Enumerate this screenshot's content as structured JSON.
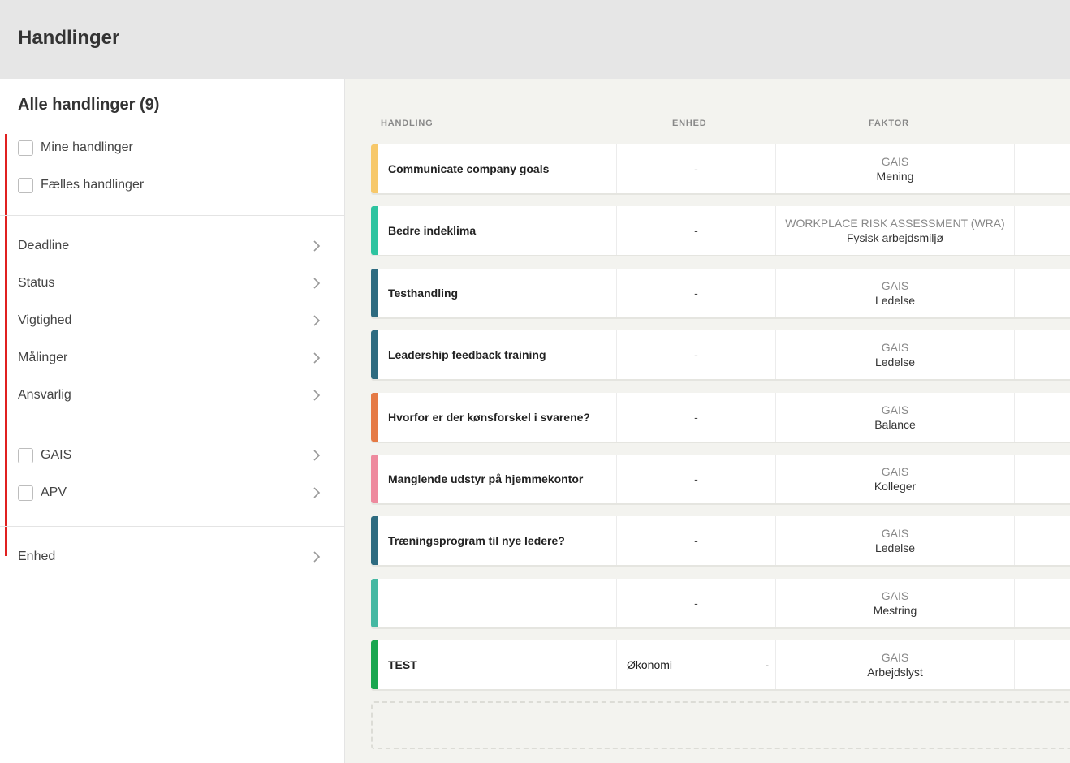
{
  "header": {
    "title": "Handlinger"
  },
  "sidebar": {
    "title": "Alle handlinger (9)",
    "checks": [
      {
        "label": "Mine handlinger"
      },
      {
        "label": "Fælles handlinger"
      }
    ],
    "filters": [
      {
        "label": "Deadline"
      },
      {
        "label": "Status"
      },
      {
        "label": "Vigtighed"
      },
      {
        "label": "Målinger"
      },
      {
        "label": "Ansvarlig"
      }
    ],
    "sources": [
      {
        "label": "GAIS"
      },
      {
        "label": "APV"
      }
    ],
    "unit_filter": {
      "label": "Enhed"
    }
  },
  "table": {
    "columns": {
      "action": "HANDLING",
      "unit": "ENHED",
      "factor": "FAKTOR"
    },
    "rows": [
      {
        "name": "Communicate company goals",
        "unit": "-",
        "factor_type": "GAIS",
        "factor": "Mening",
        "color": "#f7c86a"
      },
      {
        "name": "Bedre indeklima",
        "unit": "-",
        "factor_type": "WORKPLACE RISK ASSESSMENT (WRA)",
        "factor": "Fysisk arbejdsmiljø",
        "color": "#2ec4a0"
      },
      {
        "name": "Testhandling",
        "unit": "-",
        "factor_type": "GAIS",
        "factor": "Ledelse",
        "color": "#2e6b80"
      },
      {
        "name": "Leadership feedback training",
        "unit": "-",
        "factor_type": "GAIS",
        "factor": "Ledelse",
        "color": "#2e6b80"
      },
      {
        "name": "Hvorfor er der kønsforskel i svarene?",
        "unit": "-",
        "factor_type": "GAIS",
        "factor": "Balance",
        "color": "#e57a45"
      },
      {
        "name": "Manglende udstyr på hjemmekontor",
        "unit": "-",
        "factor_type": "GAIS",
        "factor": "Kolleger",
        "color": "#ee8a9e"
      },
      {
        "name": "Træningsprogram til nye ledere?",
        "unit": "-",
        "factor_type": "GAIS",
        "factor": "Ledelse",
        "color": "#2e6b80"
      },
      {
        "name": "",
        "unit": "-",
        "factor_type": "GAIS",
        "factor": "Mestring",
        "color": "#45b8a2"
      },
      {
        "name": "TEST",
        "unit": "Økonomi",
        "unit_dash": "-",
        "factor_type": "GAIS",
        "factor": "Arbejdslyst",
        "color": "#1aa64f"
      }
    ]
  }
}
